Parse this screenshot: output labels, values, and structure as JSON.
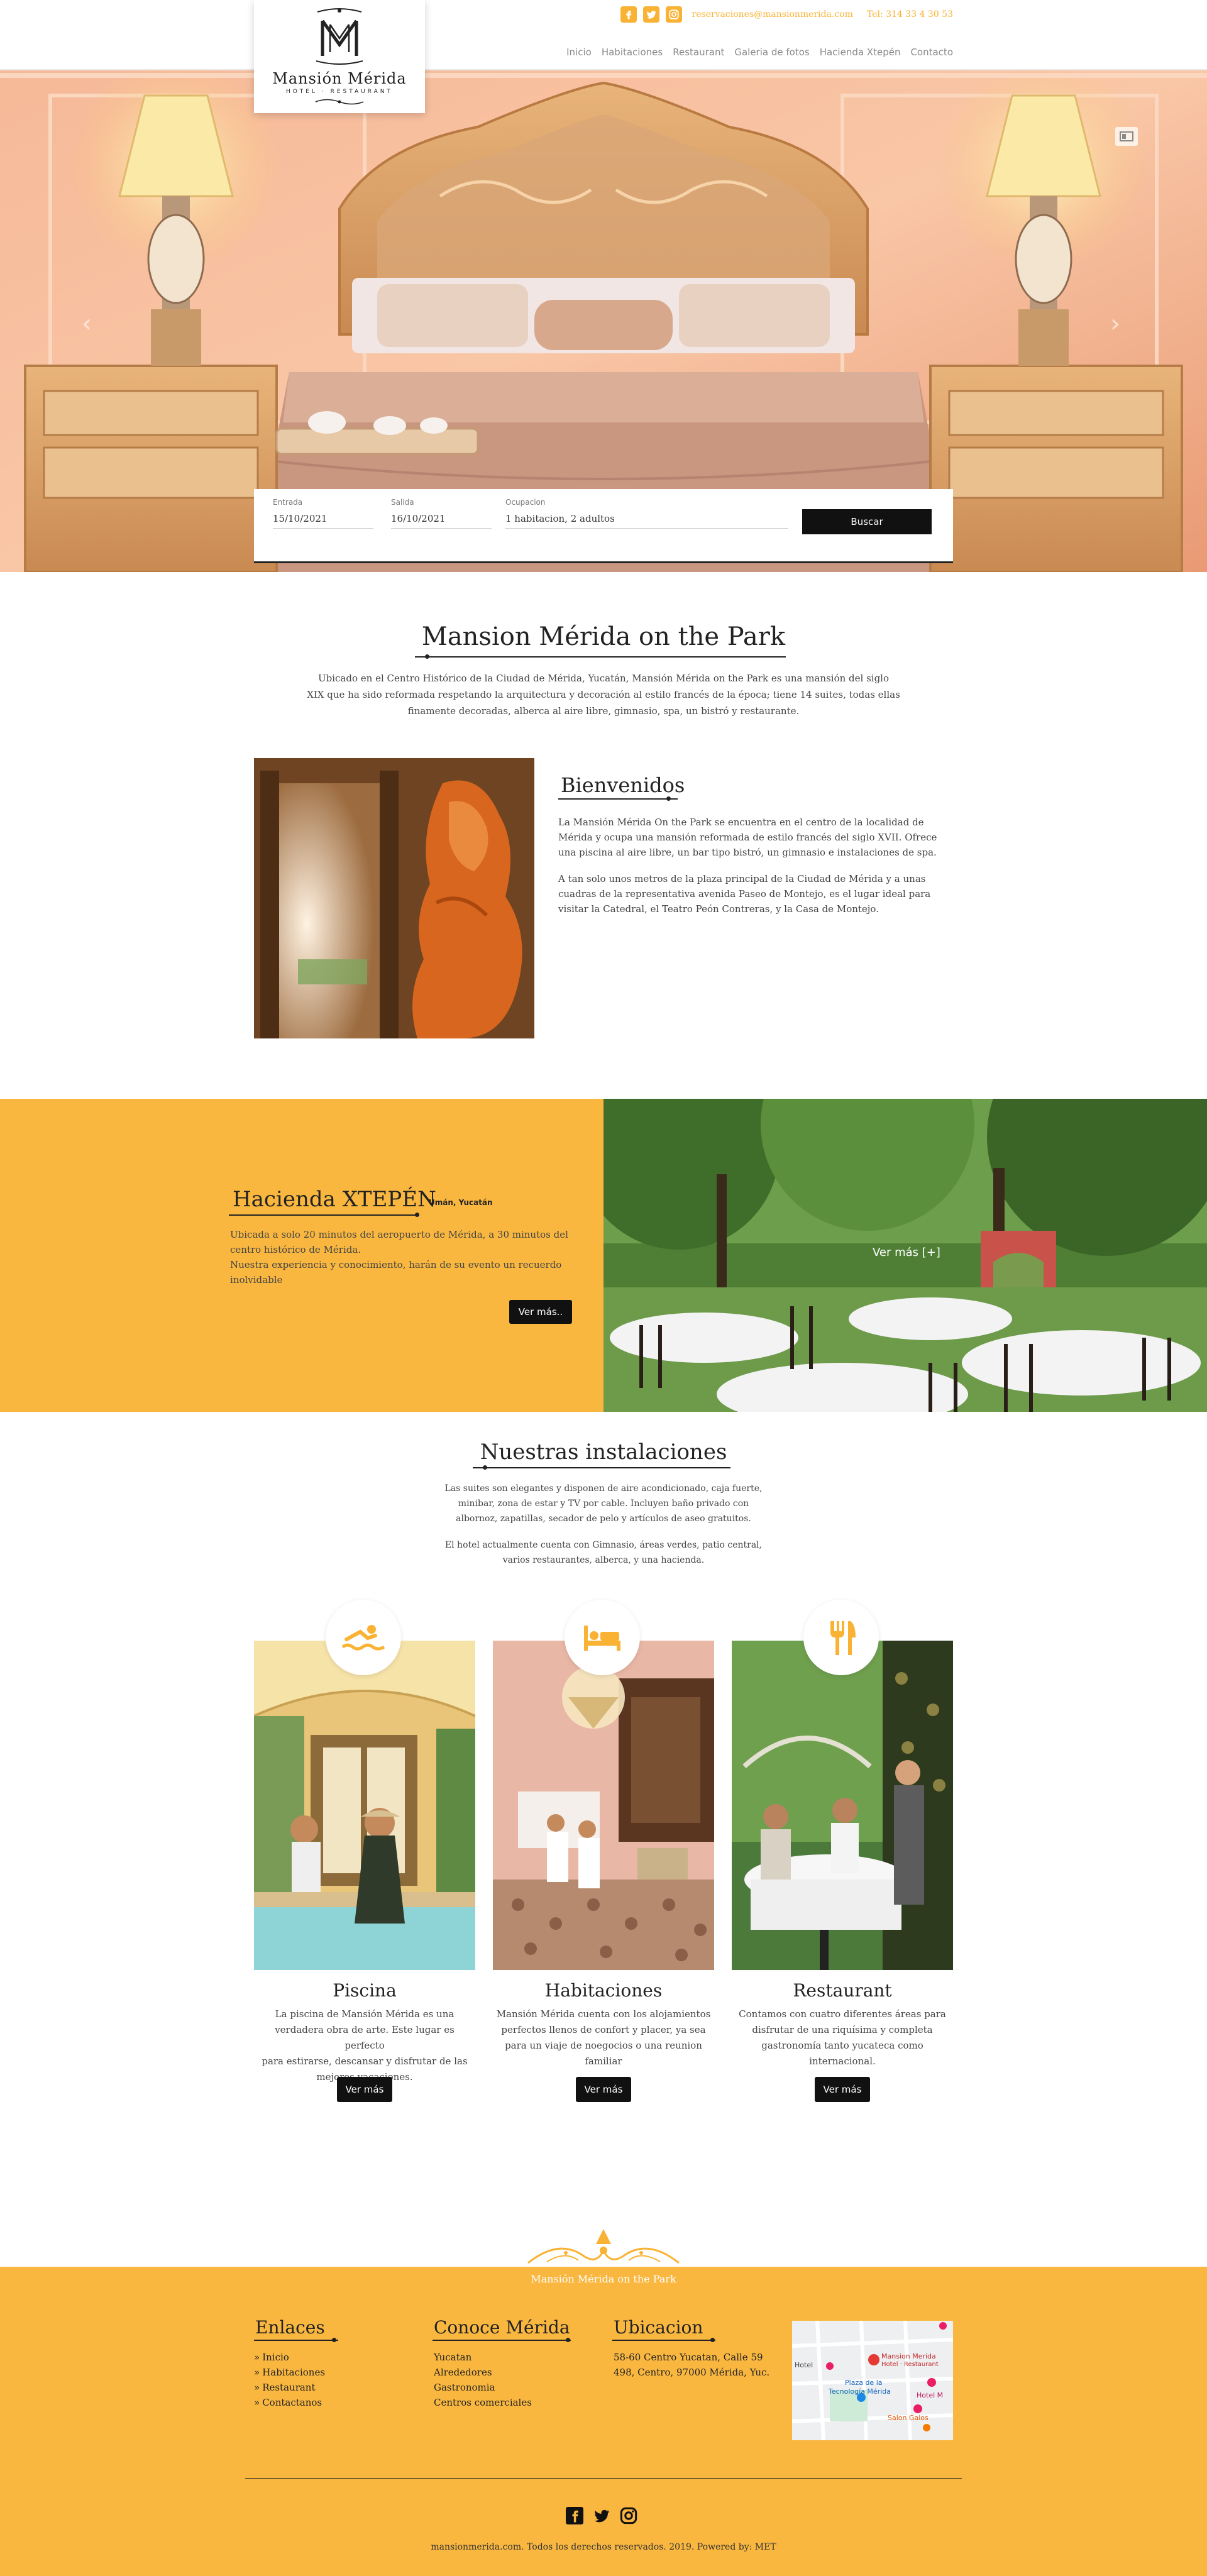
{
  "brand": {
    "logo_name": "Mansión Mérida",
    "logo_sub": "HOTEL · RESTAURANT",
    "monogram": "M"
  },
  "header": {
    "email": "reservaciones@mansionmerida.com",
    "phone": "Tel: 314 33 4 30 53",
    "social_icons": [
      "facebook-icon",
      "twitter-icon",
      "instagram-icon"
    ],
    "nav": [
      "Inicio",
      "Habitaciones",
      "Restaurant",
      "Galeria de fotos",
      "Hacienda Xtepén",
      "Contacto"
    ]
  },
  "hero": {
    "prev_arrow": "‹",
    "next_arrow": "›"
  },
  "booking": {
    "checkin_label": "Entrada",
    "checkin_value": "15/10/2021",
    "checkout_label": "Salida",
    "checkout_value": "16/10/2021",
    "guests_label": "Ocupacion",
    "guests_value": "1 habitacion, 2 adultos",
    "search_button": "Buscar"
  },
  "intro": {
    "title": "Mansion Mérida on the Park",
    "text_1": "Ubicado en el Centro Histórico de la Ciudad de Mérida, Yucatán, Mansión Mérida on the Park es una mansión del siglo",
    "text_2": "XIX que ha sido reformada respetando la arquitectura y decoración al estilo francés de la época; tiene 14 suites, todas ellas",
    "text_3": "finamente decoradas, alberca al aire libre, gimnasio, spa, un bistró y restaurante."
  },
  "welcome": {
    "title": "Bienvenidos",
    "p1_l1": "La Mansión Mérida On the Park se encuentra en el centro de la localidad de",
    "p1_l2": "Mérida y ocupa una mansión reformada de estilo francés del siglo XVII. Ofrece",
    "p1_l3": "una piscina al aire libre, un bar tipo bistró, un gimnasio e instalaciones de spa.",
    "p2_l1": "A tan solo unos metros de la plaza principal de la Ciudad de Mérida y a unas",
    "p2_l2": "cuadras de la representativa avenida Paseo de Montejo, es el lugar ideal para",
    "p2_l3": "visitar la Catedral, el Teatro Peón Contreras, y la Casa de Montejo."
  },
  "hacienda": {
    "title": "Hacienda XTEPÉN",
    "location": "Umán, Yucatán",
    "l1": "Ubicada a solo 20 minutos del aeropuerto de Mérida, a 30 minutos del",
    "l2": "centro histórico de Mérida.",
    "l3": "Nuestra experiencia y conocimiento, harán de su evento un recuerdo",
    "l4": "inolvidable",
    "button": "Ver más..",
    "overlay": "Ver más [+]"
  },
  "facilities": {
    "title": "Nuestras instalaciones",
    "p1_l1": "Las suites son elegantes y disponen de aire acondicionado, caja fuerte,",
    "p1_l2": "minibar, zona de estar y TV por cable. Incluyen baño privado con",
    "p1_l3": "albornoz, zapatillas, secador de pelo y artículos de aseo gratuitos.",
    "p2_l1": "El hotel actualmente cuenta con Gimnasio, áreas verdes, patio central,",
    "p2_l2": "varios restaurantes, alberca, y una hacienda.",
    "cards": [
      {
        "title": "Piscina",
        "l1": "La piscina de Mansión Mérida es una",
        "l2": "verdadera obra de arte. Este lugar es perfecto",
        "l3": "para estirarse, descansar y disfrutar de las",
        "l4": "mejores vacaciones.",
        "button": "Ver más",
        "icon": "swimming-icon"
      },
      {
        "title": "Habitaciones",
        "l1": "Mansión Mérida cuenta con los alojamientos",
        "l2": "perfectos llenos de confort y placer, ya sea",
        "l3": "para un viaje de noegocios o una reunion",
        "l4": "familiar",
        "button": "Ver más",
        "icon": "bed-icon"
      },
      {
        "title": "Restaurant",
        "l1": "Contamos con cuatro diferentes áreas para",
        "l2": "disfrutar de una riquísima y completa",
        "l3": "gastronomía tanto yucateca como",
        "l4": "internacional.",
        "button": "Ver más",
        "icon": "fork-knife-icon"
      }
    ]
  },
  "footer": {
    "brand_text": "Mansión Mérida on the Park",
    "links_title": "Enlaces",
    "links": [
      "Inicio",
      "Habitaciones",
      "Restaurant",
      "Contactanos"
    ],
    "merida_title": "Conoce Mérida",
    "merida": [
      "Yucatan",
      "Alrededores",
      "Gastronomia",
      "Centros comerciales"
    ],
    "location_title": "Ubicacion",
    "address_l1": "58-60 Centro Yucatan, Calle 59",
    "address_l2": "498, Centro, 97000 Mérida, Yuc.",
    "map_labels": {
      "hotel": "Hotel",
      "mansion": "Mansion Merida",
      "mansion_sub": "Hotel · Restaurant",
      "plaza": "Plaza de la",
      "tecnologia": "Tecnología Mérida",
      "hotel_m": "Hotel M",
      "salon": "Salon Galos"
    },
    "copyright": "mansionmerida.com. Todos los derechos reservados. 2019. Powered by: MET"
  },
  "colors": {
    "accent": "#F9B740",
    "dark": "#111111"
  }
}
